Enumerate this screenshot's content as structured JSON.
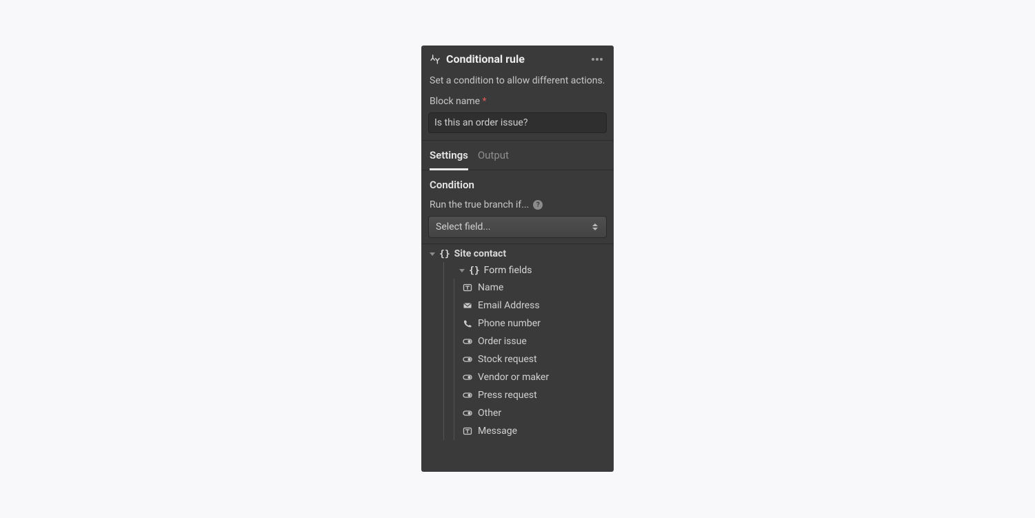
{
  "panel": {
    "title": "Conditional rule",
    "description": "Set a condition to allow different actions.",
    "block_name_label": "Block name",
    "block_name_value": "Is this an order issue?",
    "tabs": {
      "settings": "Settings",
      "output": "Output",
      "active": "settings"
    },
    "condition": {
      "heading": "Condition",
      "run_label": "Run the true branch if...",
      "select_placeholder": "Select field..."
    },
    "tree": {
      "root": {
        "label": "Site contact"
      },
      "group": {
        "label": "Form fields"
      },
      "fields": [
        {
          "icon": "text",
          "label": "Name"
        },
        {
          "icon": "email",
          "label": "Email Address"
        },
        {
          "icon": "phone",
          "label": "Phone number"
        },
        {
          "icon": "toggle",
          "label": "Order issue"
        },
        {
          "icon": "toggle",
          "label": "Stock request"
        },
        {
          "icon": "toggle",
          "label": "Vendor or maker"
        },
        {
          "icon": "toggle",
          "label": "Press request"
        },
        {
          "icon": "toggle",
          "label": "Other"
        },
        {
          "icon": "text",
          "label": "Message"
        }
      ]
    }
  }
}
